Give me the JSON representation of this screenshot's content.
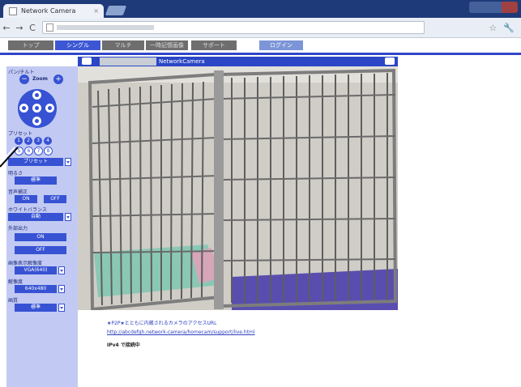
{
  "browser": {
    "tab_title": "Network Camera",
    "tab_close": "×",
    "back": "←",
    "forward": "→",
    "reload": "C",
    "star": "☆",
    "wrench": "🔧"
  },
  "menu": {
    "tabs": [
      {
        "label": "トップ",
        "active": false
      },
      {
        "label": "シングル",
        "active": true
      },
      {
        "label": "マルチ",
        "active": false
      },
      {
        "label": "一時記憶画像",
        "active": false
      },
      {
        "label": "サポート",
        "active": false
      }
    ],
    "login": "ログイン"
  },
  "camera": {
    "name": "NetworkCamera"
  },
  "panel": {
    "pan_tilt_label": "パン/チルト",
    "zoom_label": "Zoom",
    "zoom_out": "−",
    "zoom_in": "+",
    "preset_label": "プリセット",
    "presets_row1": [
      "1",
      "2",
      "3",
      "4"
    ],
    "presets_row2": [
      "5",
      "6",
      "7",
      "8"
    ],
    "preset_select": "プリセット",
    "brightness_label": "明るさ",
    "brightness_value": "標準",
    "mute_label": "音声補正",
    "on_label": "ON",
    "off_label": "OFF",
    "white_balance_label": "ホワイトバランス",
    "white_balance_value": "自動",
    "output_label": "外部出力",
    "output_on": "ON",
    "output_off": "OFF",
    "resolution_label": "画像表示解像度",
    "resolution_value": "VGA(640)",
    "size_label": "解像度",
    "size_value": "640x480",
    "quality_label": "画質",
    "quality_value": "標準"
  },
  "notes": {
    "line1": "★P2P★とともに内蔵されるカメラのアクセスURL",
    "line2": "http://abcdefgh.network-camera/homecam/support/live.html",
    "line3": "IPv4 で接続中"
  }
}
